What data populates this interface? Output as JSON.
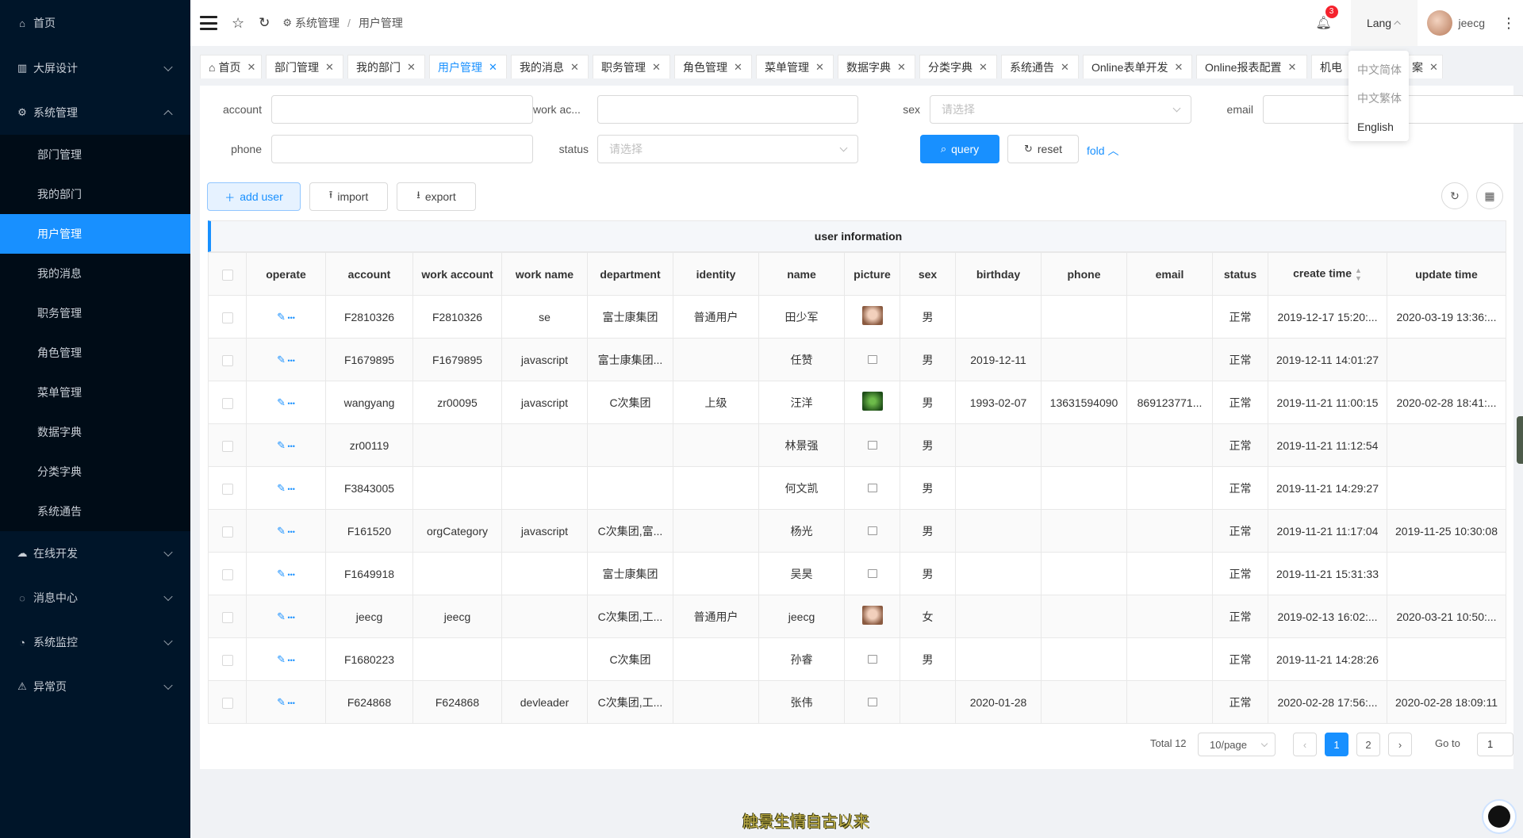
{
  "sidebar": {
    "items": [
      {
        "label": "首页",
        "icon": "home-icon"
      },
      {
        "label": "大屏设计",
        "icon": "chart-icon"
      },
      {
        "label": "系统管理",
        "icon": "gear-icon"
      },
      {
        "label": "在线开发",
        "icon": "cloud-icon"
      },
      {
        "label": "消息中心",
        "icon": "message-icon"
      },
      {
        "label": "系统监控",
        "icon": "dashboard-icon"
      },
      {
        "label": "异常页",
        "icon": "warning-icon"
      }
    ],
    "submenu": [
      "部门管理",
      "我的部门",
      "用户管理",
      "我的消息",
      "职务管理",
      "角色管理",
      "菜单管理",
      "数据字典",
      "分类字典",
      "系统通告"
    ],
    "active": "用户管理"
  },
  "header": {
    "breadcrumb": [
      "系统管理",
      "用户管理"
    ],
    "notification_count": "3",
    "lang_label": "Lang",
    "username": "jeecg"
  },
  "tabs": [
    "首页",
    "部门管理",
    "我的部门",
    "用户管理",
    "我的消息",
    "职务管理",
    "角色管理",
    "菜单管理",
    "数据字典",
    "分类字典",
    "系统通告",
    "Online表单开发",
    "Online报表配置",
    "机电",
    "案"
  ],
  "lang_menu": [
    "中文简体",
    "中文繁体",
    "English"
  ],
  "search": {
    "account_label": "account",
    "work_account_label": "work ac...",
    "sex_label": "sex",
    "sex_placeholder": "请选择",
    "email_label": "email",
    "phone_label": "phone",
    "status_label": "status",
    "status_placeholder": "请选择",
    "query": "query",
    "reset": "reset",
    "fold": "fold"
  },
  "toolbar": {
    "add_user": "add user",
    "import": "import",
    "export": "export"
  },
  "table": {
    "title": "user information",
    "columns": [
      "operate",
      "account",
      "work account",
      "work name",
      "department",
      "identity",
      "name",
      "picture",
      "sex",
      "birthday",
      "phone",
      "email",
      "status",
      "create time",
      "update time"
    ],
    "rows": [
      {
        "account": "F2810326",
        "work_account": "F2810326",
        "work_name": "se",
        "department": "富士康集团",
        "identity": "普通用户",
        "name": "田少军",
        "picture": "face",
        "sex": "男",
        "birthday": "",
        "phone": "",
        "email": "",
        "status": "正常",
        "create_time": "2019-12-17 15:20:...",
        "update_time": "2020-03-19 13:36:..."
      },
      {
        "account": "F1679895",
        "work_account": "F1679895",
        "work_name": "javascript",
        "department": "富士康集团...",
        "identity": "",
        "name": "任赞",
        "picture": "broken",
        "sex": "男",
        "birthday": "2019-12-11",
        "phone": "",
        "email": "",
        "status": "正常",
        "create_time": "2019-12-11 14:01:27",
        "update_time": ""
      },
      {
        "account": "wangyang",
        "work_account": "zr00095",
        "work_name": "javascript",
        "department": "C次集团",
        "identity": "上级",
        "name": "汪洋",
        "picture": "leaf",
        "sex": "男",
        "birthday": "1993-02-07",
        "phone": "13631594090",
        "email": "869123771...",
        "status": "正常",
        "create_time": "2019-11-21 11:00:15",
        "update_time": "2020-02-28 18:41:..."
      },
      {
        "account": "zr00119",
        "work_account": "",
        "work_name": "",
        "department": "",
        "identity": "",
        "name": "林景强",
        "picture": "broken",
        "sex": "男",
        "birthday": "",
        "phone": "",
        "email": "",
        "status": "正常",
        "create_time": "2019-11-21 11:12:54",
        "update_time": ""
      },
      {
        "account": "F3843005",
        "work_account": "",
        "work_name": "",
        "department": "",
        "identity": "",
        "name": "何文凯",
        "picture": "broken",
        "sex": "男",
        "birthday": "",
        "phone": "",
        "email": "",
        "status": "正常",
        "create_time": "2019-11-21 14:29:27",
        "update_time": ""
      },
      {
        "account": "F161520",
        "work_account": "orgCategory",
        "work_name": "javascript",
        "department": "C次集团,富...",
        "identity": "",
        "name": "杨光",
        "picture": "broken",
        "sex": "男",
        "birthday": "",
        "phone": "",
        "email": "",
        "status": "正常",
        "create_time": "2019-11-21 11:17:04",
        "update_time": "2019-11-25 10:30:08"
      },
      {
        "account": "F1649918",
        "work_account": "",
        "work_name": "",
        "department": "富士康集团",
        "identity": "",
        "name": "吴昊",
        "picture": "broken",
        "sex": "男",
        "birthday": "",
        "phone": "",
        "email": "",
        "status": "正常",
        "create_time": "2019-11-21 15:31:33",
        "update_time": ""
      },
      {
        "account": "jeecg",
        "work_account": "jeecg",
        "work_name": "",
        "department": "C次集团,工...",
        "identity": "普通用户",
        "name": "jeecg",
        "picture": "face",
        "sex": "女",
        "birthday": "",
        "phone": "",
        "email": "",
        "status": "正常",
        "create_time": "2019-02-13 16:02:...",
        "update_time": "2020-03-21 10:50:..."
      },
      {
        "account": "F1680223",
        "work_account": "",
        "work_name": "",
        "department": "C次集团",
        "identity": "",
        "name": "孙睿",
        "picture": "broken",
        "sex": "男",
        "birthday": "",
        "phone": "",
        "email": "",
        "status": "正常",
        "create_time": "2019-11-21 14:28:26",
        "update_time": ""
      },
      {
        "account": "F624868",
        "work_account": "F624868",
        "work_name": "devleader",
        "department": "C次集团,工...",
        "identity": "",
        "name": "张伟",
        "picture": "broken",
        "sex": "",
        "birthday": "2020-01-28",
        "phone": "",
        "email": "",
        "status": "正常",
        "create_time": "2020-02-28 17:56:...",
        "update_time": "2020-02-28 18:09:11"
      }
    ]
  },
  "pagination": {
    "total": "Total 12",
    "page_size": "10/page",
    "pages": [
      "1",
      "2"
    ],
    "current": "1",
    "goto_label": "Go to",
    "goto_value": "1"
  },
  "footer_text": "触景生情自古以来",
  "colors": {
    "primary": "#1890ff",
    "sidebar_bg": "#001529",
    "badge": "#f5222d"
  }
}
